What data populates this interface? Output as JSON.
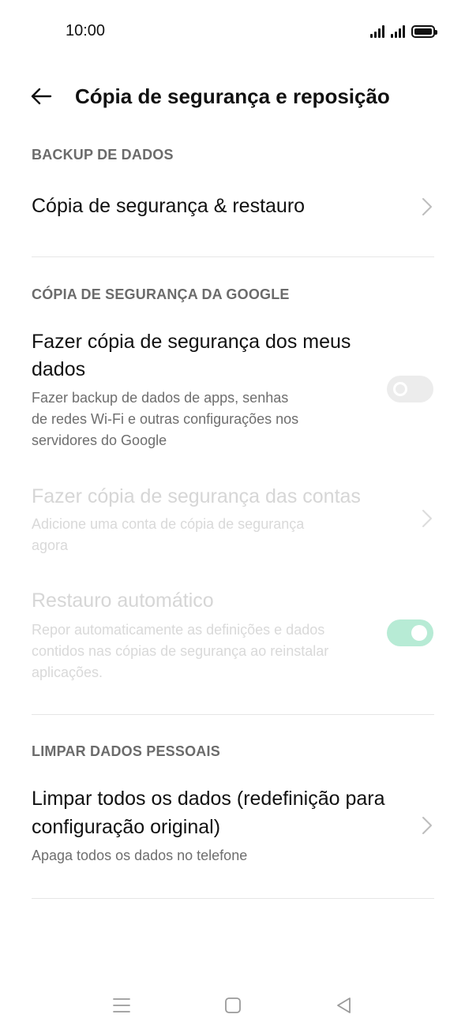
{
  "status_bar": {
    "time": "10:00"
  },
  "header": {
    "title": "Cópia de segurança e reposição"
  },
  "sections": {
    "backup_dados": {
      "header": "BACKUP DE DADOS",
      "item_restore": {
        "title": "Cópia de segurança & restauro"
      }
    },
    "google_backup": {
      "header": "CÓPIA DE SEGURANÇA DA GOOGLE",
      "item_backup_my_data": {
        "title_line1": "Fazer cópia de segurança dos meus",
        "title_line2": "dados",
        "sub_line1": "Fazer backup de dados de apps, senhas",
        "sub_line2": "de redes Wi-Fi e outras configurações nos",
        "sub_line3": "servidores do Google",
        "toggle_state": "off"
      },
      "item_backup_accounts": {
        "title": "Fazer cópia de segurança das contas",
        "sub_line1": "Adicione uma conta de cópia de segurança",
        "sub_line2": "agora",
        "enabled": false
      },
      "item_auto_restore": {
        "title": "Restauro automático",
        "sub_line1": "Repor automaticamente as definições e dados",
        "sub_line2": "contidos nas cópias de segurança ao reinstalar",
        "sub_line3": "aplicações.",
        "toggle_state": "on",
        "enabled": false
      }
    },
    "personal_data": {
      "header": "LIMPAR DADOS PESSOAIS",
      "item_factory_reset": {
        "title_line1": "Limpar todos os dados (redefinição para",
        "title_line2": "configuração original)",
        "sub": "Apaga todos os dados no telefone"
      }
    }
  },
  "colors": {
    "toggle_on": "#b7ebd5",
    "toggle_off": "#ececec",
    "section_header": "#6b6b6b",
    "disabled_text": "#d6d6d6"
  },
  "icons": {
    "back": "arrow-left-icon",
    "chevron": "chevron-right-icon",
    "nav_menu": "menu-icon",
    "nav_home": "home-square-icon",
    "nav_back": "back-triangle-icon"
  }
}
